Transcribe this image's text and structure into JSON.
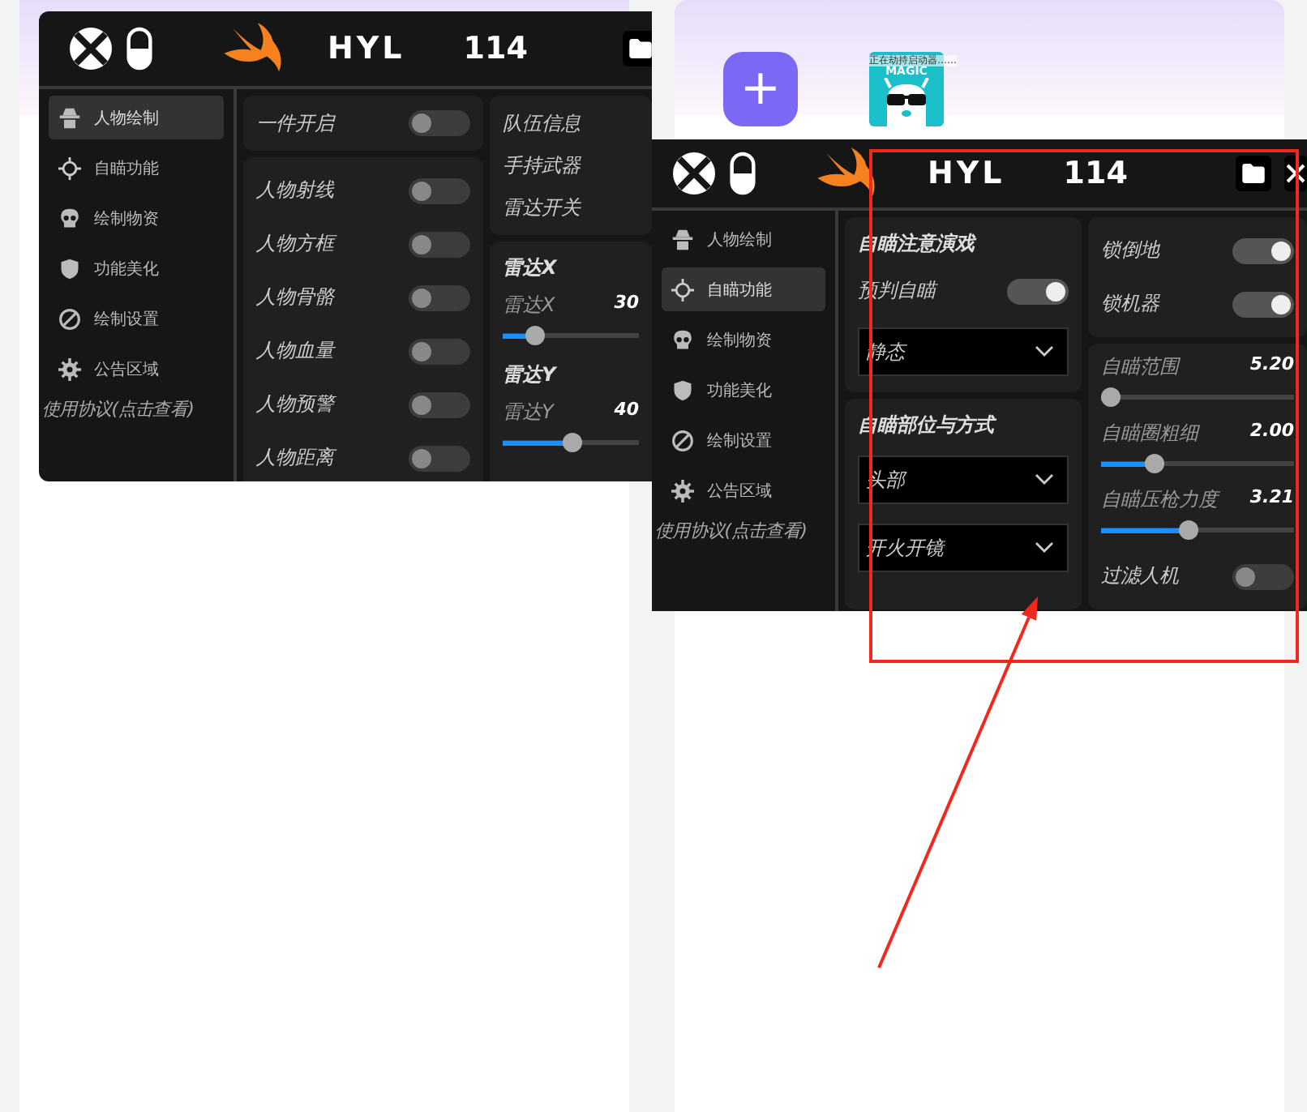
{
  "launcher": {
    "add_button": "+",
    "app": {
      "caption": "正在劫持启动器……",
      "logo_text": "MAGIC"
    }
  },
  "windows": [
    {
      "title": "HYL",
      "version": "114",
      "close": false,
      "sidebar": [
        {
          "label": "人物绘制",
          "selected": true
        },
        {
          "label": "自瞄功能",
          "selected": false
        },
        {
          "label": "绘制物资",
          "selected": false
        },
        {
          "label": "功能美化",
          "selected": false
        },
        {
          "label": "绘制设置",
          "selected": false
        },
        {
          "label": "公告区域",
          "selected": false
        }
      ],
      "agreement": "使用协议(点击查看)",
      "columns": [
        {
          "cards": [
            {
              "items": [
                {
                  "kind": "toggle",
                  "label": "一件开启",
                  "on": false
                }
              ]
            },
            {
              "items": [
                {
                  "kind": "toggle",
                  "label": "人物射线",
                  "on": false
                },
                {
                  "kind": "toggle",
                  "label": "人物方框",
                  "on": false
                },
                {
                  "kind": "toggle",
                  "label": "人物骨骼",
                  "on": false
                },
                {
                  "kind": "toggle",
                  "label": "人物血量",
                  "on": false
                },
                {
                  "kind": "toggle",
                  "label": "人物预警",
                  "on": false
                },
                {
                  "kind": "toggle",
                  "label": "人物距离",
                  "on": false
                }
              ]
            }
          ]
        },
        {
          "cards": [
            {
              "items": [
                {
                  "kind": "label",
                  "label": "队伍信息"
                },
                {
                  "kind": "label",
                  "label": "手持武器"
                },
                {
                  "kind": "label",
                  "label": "雷达开关"
                }
              ]
            },
            {
              "items": [
                {
                  "kind": "heading",
                  "label": "雷达X"
                },
                {
                  "kind": "slider",
                  "label": "雷达X",
                  "value": "30",
                  "level": 0.2
                },
                {
                  "kind": "heading",
                  "label": "雷达Y"
                },
                {
                  "kind": "slider",
                  "label": "雷达Y",
                  "value": "40",
                  "level": 0.52
                }
              ]
            }
          ]
        }
      ]
    },
    {
      "title": "HYL",
      "version": "114",
      "close": true,
      "sidebar": [
        {
          "label": "人物绘制",
          "selected": false
        },
        {
          "label": "自瞄功能",
          "selected": true
        },
        {
          "label": "绘制物资",
          "selected": false
        },
        {
          "label": "功能美化",
          "selected": false
        },
        {
          "label": "绘制设置",
          "selected": false
        },
        {
          "label": "公告区域",
          "selected": false
        }
      ],
      "agreement": "使用协议(点击查看)",
      "columns": [
        {
          "cards": [
            {
              "items": [
                {
                  "kind": "heading",
                  "label": "自瞄注意演戏"
                },
                {
                  "kind": "toggle",
                  "label": "预判自瞄",
                  "on": true
                },
                {
                  "kind": "dropdown",
                  "label": "静态"
                }
              ]
            },
            {
              "items": [
                {
                  "kind": "heading",
                  "label": "自瞄部位与方式"
                },
                {
                  "kind": "dropdown",
                  "label": "头部"
                },
                {
                  "kind": "dropdown",
                  "label": "开火开镜"
                }
              ]
            }
          ]
        },
        {
          "cards": [
            {
              "items": [
                {
                  "kind": "toggle",
                  "label": "锁倒地",
                  "on": true
                },
                {
                  "kind": "toggle",
                  "label": "锁机器",
                  "on": true
                }
              ]
            },
            {
              "items": [
                {
                  "kind": "slider",
                  "label": "自瞄范围",
                  "value": "5.20",
                  "level": 0.0
                },
                {
                  "kind": "slider",
                  "label": "自瞄圈粗细",
                  "value": "2.00",
                  "level": 0.25
                },
                {
                  "kind": "slider",
                  "label": "自瞄压枪力度",
                  "value": "3.21",
                  "level": 0.45
                },
                {
                  "kind": "toggle",
                  "label": "过滤人机",
                  "on": false
                }
              ]
            }
          ]
        }
      ]
    }
  ]
}
